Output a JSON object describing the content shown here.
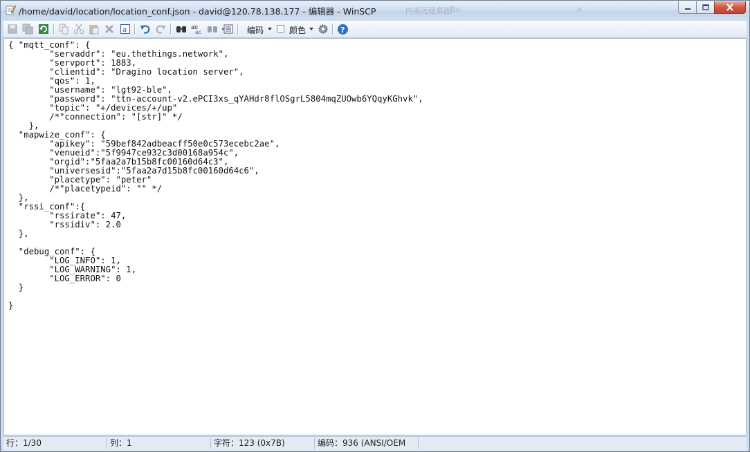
{
  "window": {
    "title": "/home/david/location/location_conf.json - david@120.78.138.177 - 编辑器 - WinSCP",
    "ghost_text_1": "内嵌远程桌面",
    "ghost_text_2": "Bo",
    "ghost_text_3": "×"
  },
  "toolbar": {
    "icons": [
      "save-icon",
      "save-all-icon",
      "reload-icon",
      "copy-icon",
      "cut-icon",
      "paste-icon",
      "delete-icon",
      "select-all-icon",
      "undo-icon",
      "redo-icon",
      "find-icon",
      "replace-icon",
      "find-next-icon",
      "go-to-line-icon",
      "settings-icon",
      "help-icon"
    ],
    "encoding_label": "编码",
    "color_label": "颜色",
    "accent_color": "#2f6fc5"
  },
  "editor": {
    "lines": [
      "{ \"mqtt_conf\": {",
      "        \"servaddr\": \"eu.thethings.network\",",
      "        \"servport\": 1883,",
      "        \"clientid\": \"Dragino location server\",",
      "        \"qos\": 1,",
      "        \"username\": \"lgt92-ble\",",
      "        \"password\": \"ttn-account-v2.ePCI3xs_qYAHdr8flOSgrL5804mqZUOwb6YQqyKGhvk\",",
      "        \"topic\": \"+/devices/+/up\"",
      "        /*\"connection\": \"[str]\" */",
      "    },",
      "  \"mapwize_conf\": {",
      "        \"apikey\": \"59bef842adbeacff50e0c573ecebc2ae\",",
      "        \"venueid\":\"5f9947ce932c3d00168a954c\",",
      "        \"orgid\":\"5faa2a7b15b8fc00160d64c3\",",
      "        \"universesid\":\"5faa2a7d15b8fc00160d64c6\",",
      "        \"placetype\": \"peter\"",
      "        /*\"placetypeid\": \"\" */",
      "  },",
      "  \"rssi_conf\":{",
      "        \"rssirate\": 47,",
      "        \"rssidiv\": 2.0",
      "  },",
      "",
      "  \"debug_conf\": {",
      "        \"LOG_INFO\": 1,",
      "        \"LOG_WARNING\": 1,",
      "        \"LOG_ERROR\": 0",
      "  }",
      "",
      "}"
    ]
  },
  "status": {
    "line": "行：1/30",
    "column": "列：1",
    "char": "字符：123 (0x7B)",
    "encoding": "编码：936  (ANSI/OEM"
  }
}
